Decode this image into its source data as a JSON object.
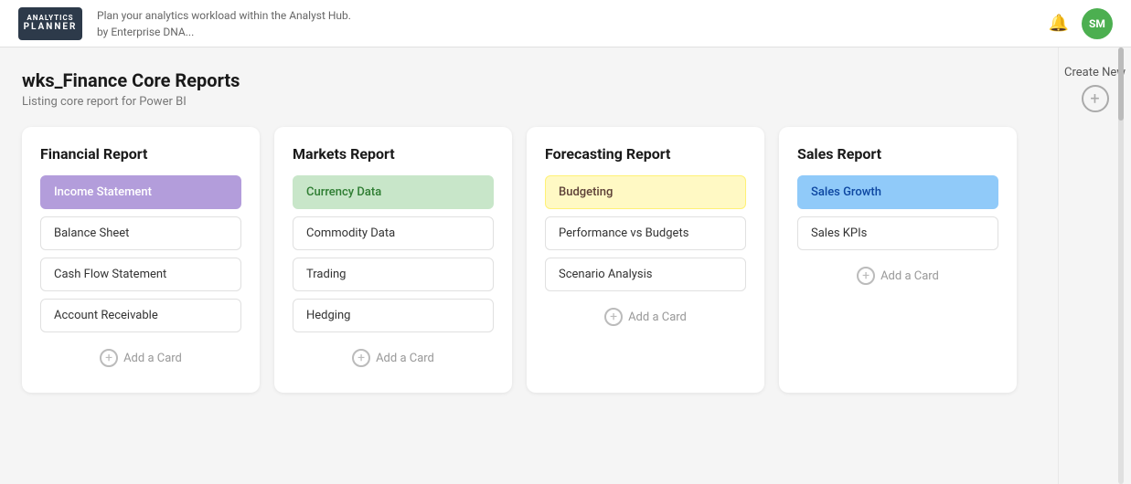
{
  "logo": {
    "line1": "ANALYTICS",
    "line2": "PLANNER"
  },
  "header": {
    "subtitle_line1": "Plan your analytics workload within the Analyst Hub.",
    "subtitle_line2": "by Enterprise DNA...",
    "avatar_initials": "SM"
  },
  "page": {
    "title": "wks_Finance Core Reports",
    "subtitle": "Listing core report for Power BI"
  },
  "sidebar": {
    "create_new_label": "Create New"
  },
  "reports": [
    {
      "id": "financial",
      "title": "Financial Report",
      "items": [
        {
          "label": "Income Statement",
          "highlight": "purple"
        },
        {
          "label": "Balance Sheet",
          "highlight": "none"
        },
        {
          "label": "Cash Flow Statement",
          "highlight": "none"
        },
        {
          "label": "Account Receivable",
          "highlight": "none"
        }
      ],
      "add_label": "Add a Card"
    },
    {
      "id": "markets",
      "title": "Markets Report",
      "items": [
        {
          "label": "Currency Data",
          "highlight": "green"
        },
        {
          "label": "Commodity Data",
          "highlight": "none"
        },
        {
          "label": "Trading",
          "highlight": "none"
        },
        {
          "label": "Hedging",
          "highlight": "none"
        }
      ],
      "add_label": "Add a Card"
    },
    {
      "id": "forecasting",
      "title": "Forecasting Report",
      "items": [
        {
          "label": "Budgeting",
          "highlight": "yellow"
        },
        {
          "label": "Performance vs Budgets",
          "highlight": "none"
        },
        {
          "label": "Scenario Analysis",
          "highlight": "none"
        }
      ],
      "add_label": "Add a Card"
    },
    {
      "id": "sales",
      "title": "Sales Report",
      "items": [
        {
          "label": "Sales Growth",
          "highlight": "blue"
        },
        {
          "label": "Sales KPIs",
          "highlight": "none"
        }
      ],
      "add_label": "Add a Card"
    }
  ]
}
